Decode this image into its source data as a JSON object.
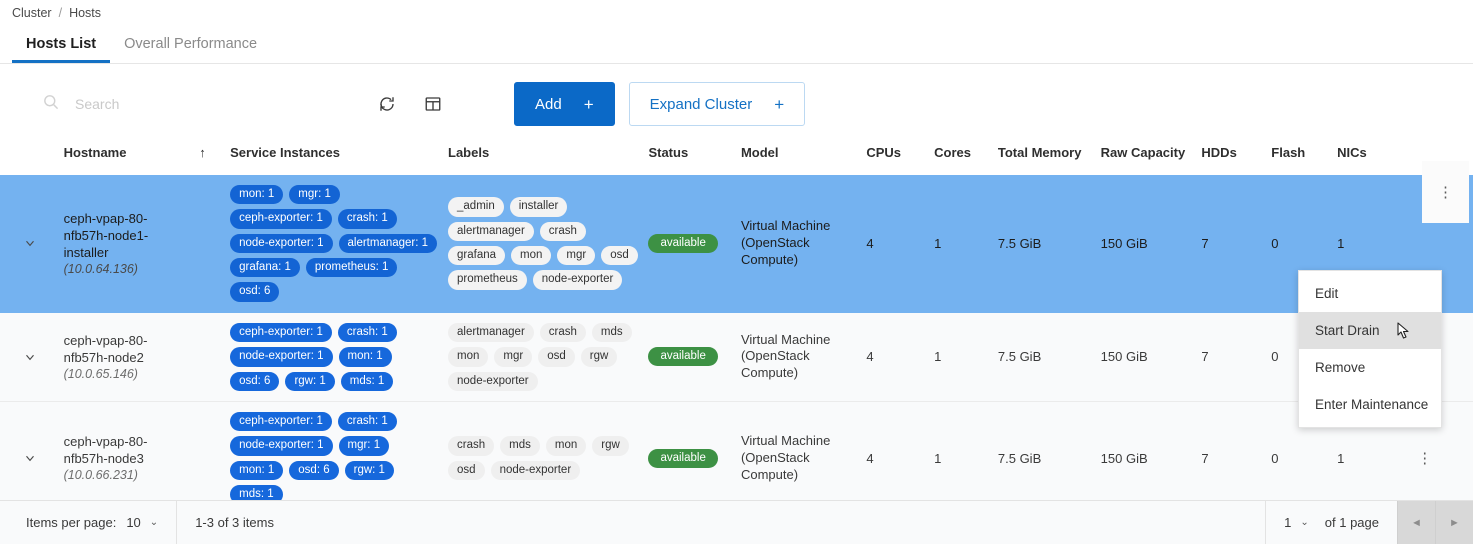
{
  "breadcrumb": {
    "items": [
      "Cluster",
      "Hosts"
    ],
    "separator": "/"
  },
  "tabs": [
    {
      "label": "Hosts List",
      "active": true
    },
    {
      "label": "Overall Performance",
      "active": false
    }
  ],
  "toolbar": {
    "search": {
      "placeholder": "Search",
      "value": "",
      "icon": "search-icon"
    },
    "refresh_icon": "refresh-icon",
    "table_settings_icon": "table-settings-icon",
    "add_button": {
      "label": "Add",
      "suffix": "+"
    },
    "expand_cluster_button": {
      "label": "Expand Cluster",
      "suffix": "+"
    }
  },
  "table": {
    "columns": [
      "Hostname",
      "Service Instances",
      "Labels",
      "Status",
      "Model",
      "CPUs",
      "Cores",
      "Total Memory",
      "Raw Capacity",
      "HDDs",
      "Flash",
      "NICs"
    ],
    "sort": {
      "column": "Hostname",
      "direction": "asc",
      "icon": "arrow-up-icon"
    },
    "rows": [
      {
        "selected": true,
        "hostname": "ceph-vpap-80-nfb57h-node1-installer",
        "ip": "(10.0.64.136)",
        "services": [
          "mon: 1",
          "mgr: 1",
          "ceph-exporter: 1",
          "crash: 1",
          "node-exporter: 1",
          "alertmanager: 1",
          "grafana: 1",
          "prometheus: 1",
          "osd: 6"
        ],
        "labels": [
          "_admin",
          "installer",
          "alertmanager",
          "crash",
          "grafana",
          "mon",
          "mgr",
          "osd",
          "prometheus",
          "node-exporter"
        ],
        "status": "available",
        "model": "Virtual Machine (OpenStack Compute)",
        "cpus": "4",
        "cores": "1",
        "total_memory": "7.5 GiB",
        "raw_capacity": "150 GiB",
        "hdds": "7",
        "flash": "0",
        "nics": "1"
      },
      {
        "selected": false,
        "hostname": "ceph-vpap-80-nfb57h-node2",
        "ip": "(10.0.65.146)",
        "services": [
          "ceph-exporter: 1",
          "crash: 1",
          "node-exporter: 1",
          "mon: 1",
          "osd: 6",
          "rgw: 1",
          "mds: 1"
        ],
        "labels": [
          "alertmanager",
          "crash",
          "mds",
          "mon",
          "mgr",
          "osd",
          "rgw",
          "node-exporter"
        ],
        "status": "available",
        "model": "Virtual Machine (OpenStack Compute)",
        "cpus": "4",
        "cores": "1",
        "total_memory": "7.5 GiB",
        "raw_capacity": "150 GiB",
        "hdds": "7",
        "flash": "0",
        "nics": ""
      },
      {
        "selected": false,
        "hostname": "ceph-vpap-80-nfb57h-node3",
        "ip": "(10.0.66.231)",
        "services": [
          "ceph-exporter: 1",
          "crash: 1",
          "node-exporter: 1",
          "mgr: 1",
          "mon: 1",
          "osd: 6",
          "rgw: 1",
          "mds: 1"
        ],
        "labels": [
          "crash",
          "mds",
          "mon",
          "rgw",
          "osd",
          "node-exporter"
        ],
        "status": "available",
        "model": "Virtual Machine (OpenStack Compute)",
        "cpus": "4",
        "cores": "1",
        "total_memory": "7.5 GiB",
        "raw_capacity": "150 GiB",
        "hdds": "7",
        "flash": "0",
        "nics": "1"
      }
    ]
  },
  "context_menu": {
    "open": true,
    "items": [
      {
        "label": "Edit",
        "hovered": false
      },
      {
        "label": "Start Drain",
        "hovered": true
      },
      {
        "label": "Remove",
        "hovered": false
      },
      {
        "label": "Enter Maintenance",
        "hovered": false
      }
    ]
  },
  "footer": {
    "items_per_page_label": "Items per page:",
    "items_per_page_value": "10",
    "range_text": "1-3 of 3 items",
    "page_value": "1",
    "of_pages_text": "of 1 page",
    "prev_icon": "chevron-left-icon",
    "next_icon": "chevron-right-icon"
  },
  "colors": {
    "primary": "#0b69c7",
    "link": "#1471c4",
    "selected_row": "#74b2f0",
    "chip_service": "#1668dc",
    "status_available": "#3d9144"
  }
}
